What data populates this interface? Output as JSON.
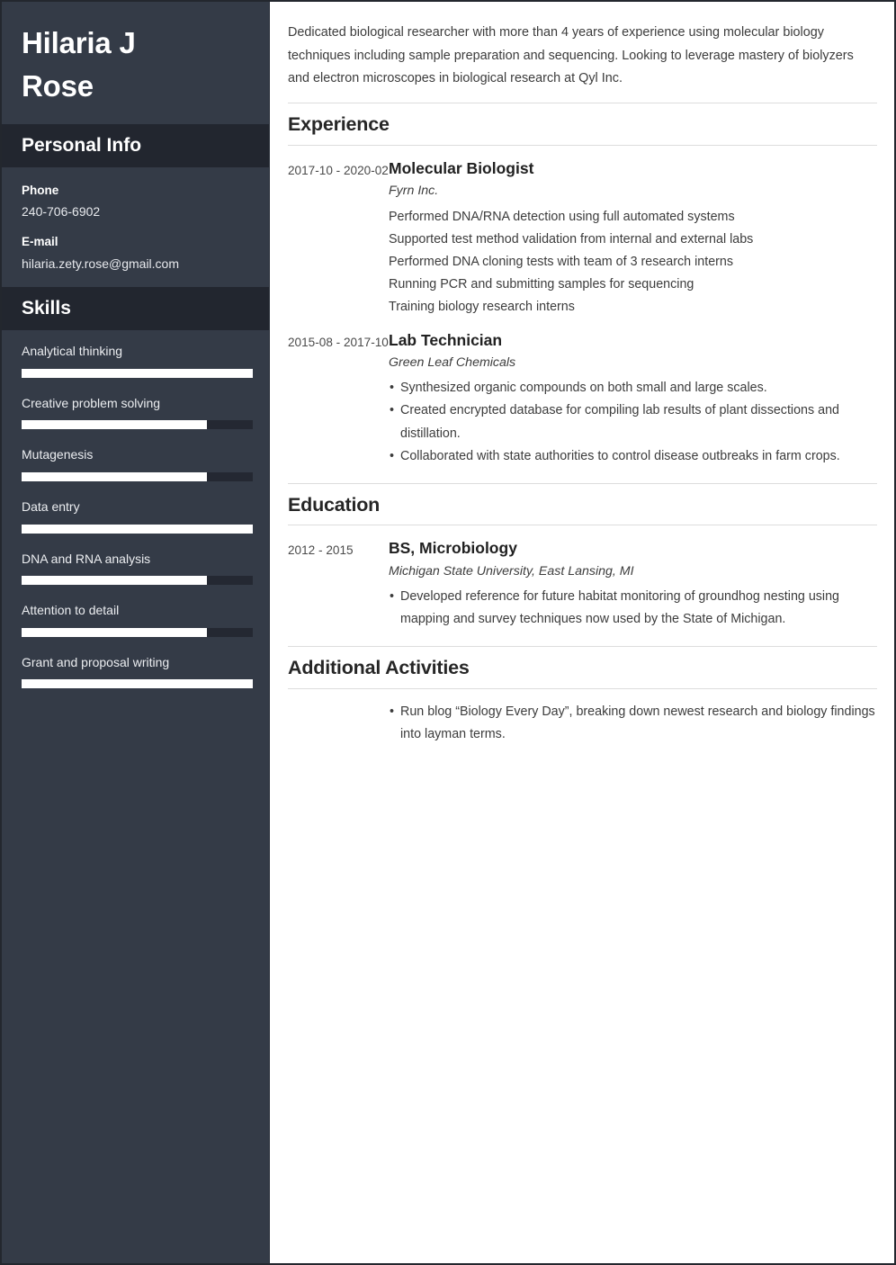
{
  "sidebar": {
    "name_lines": [
      "Hilaria J",
      "Rose"
    ],
    "personal_info": {
      "heading": "Personal Info",
      "fields": [
        {
          "label": "Phone",
          "value": "240-706-6902"
        },
        {
          "label": "E-mail",
          "value": "hilaria.zety.rose@gmail.com"
        }
      ]
    },
    "skills": {
      "heading": "Skills",
      "items": [
        {
          "label": "Analytical thinking",
          "level": 100
        },
        {
          "label": "Creative problem solving",
          "level": 80
        },
        {
          "label": "Mutagenesis",
          "level": 80
        },
        {
          "label": "Data entry",
          "level": 100
        },
        {
          "label": "DNA and RNA analysis",
          "level": 80
        },
        {
          "label": "Attention to detail",
          "level": 80
        },
        {
          "label": "Grant and proposal writing",
          "level": 100
        }
      ]
    }
  },
  "main": {
    "summary": "Dedicated biological researcher with more than 4 years of experience using molecular biology techniques including sample preparation and sequencing. Looking to leverage mastery of biolyzers and electron microscopes in biological research at Qyl Inc.",
    "experience": {
      "heading": "Experience",
      "entries": [
        {
          "dates": "2017-10 - 2020-02",
          "title": "Molecular Biologist",
          "org": "Fyrn Inc.",
          "bulleted": false,
          "items": [
            "Performed DNA/RNA detection using full automated systems",
            "Supported test method validation from internal and external labs",
            "Performed DNA cloning tests with team of 3 research interns",
            "Running PCR and submitting samples for sequencing",
            "Training biology research interns"
          ]
        },
        {
          "dates": "2015-08 - 2017-10",
          "title": "Lab Technician",
          "org": "Green Leaf Chemicals",
          "bulleted": true,
          "items": [
            "Synthesized organic compounds on both small and large scales.",
            "Created encrypted database for compiling lab results of plant dissections and distillation.",
            "Collaborated with state authorities to control disease outbreaks in farm crops."
          ]
        }
      ]
    },
    "education": {
      "heading": "Education",
      "entries": [
        {
          "dates": "2012 - 2015",
          "title": "BS, Microbiology",
          "org": "Michigan State University, East Lansing, MI",
          "bulleted": true,
          "items": [
            "Developed reference for future habitat monitoring of groundhog nesting using mapping and survey techniques now used by the State of Michigan."
          ]
        }
      ]
    },
    "additional_activities": {
      "heading": "Additional Activities",
      "entries": [
        {
          "dates": "",
          "title": "",
          "org": "",
          "bulleted": true,
          "items": [
            "Run blog “Biology Every Day”, breaking down newest research and biology findings into layman terms."
          ]
        }
      ]
    }
  },
  "colors": {
    "sidebar_bg": "#343b47",
    "sidebar_head_bg": "#22262f",
    "page_border": "#23272e",
    "bar_fill": "#ffffff",
    "bar_track": "#242832",
    "rule": "#dddddd"
  }
}
